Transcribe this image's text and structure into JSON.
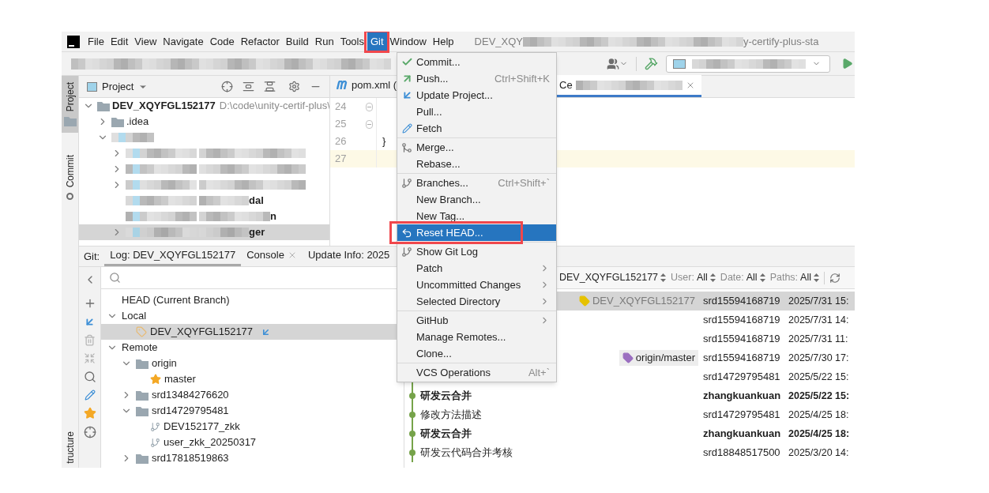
{
  "menubar": {
    "items": [
      {
        "label": "File",
        "selected": false,
        "framed": false
      },
      {
        "label": "Edit",
        "selected": false,
        "framed": false
      },
      {
        "label": "View",
        "selected": false,
        "framed": false
      },
      {
        "label": "Navigate",
        "selected": false,
        "framed": false
      },
      {
        "label": "Code",
        "selected": false,
        "framed": false
      },
      {
        "label": "Refactor",
        "selected": false,
        "framed": false
      },
      {
        "label": "Build",
        "selected": false,
        "framed": false
      },
      {
        "label": "Run",
        "selected": false,
        "framed": false
      },
      {
        "label": "Tools",
        "selected": false,
        "framed": false
      },
      {
        "label": "Git",
        "selected": true,
        "framed": true
      },
      {
        "label": "Window",
        "selected": false,
        "framed": false
      },
      {
        "label": "Help",
        "selected": false,
        "framed": false
      }
    ],
    "title_parts": [
      "DEV_XQY",
      "y-certify-plus-sta"
    ]
  },
  "side_tabs": [
    {
      "label": "Project",
      "kind": "project",
      "selected": true
    },
    {
      "label": "Commit",
      "kind": "commit",
      "selected": false
    }
  ],
  "bottom_side_tab": {
    "label": "tructure"
  },
  "project_panel": {
    "title": "Project",
    "tree": [
      {
        "kind": "node",
        "label": "DEV_XQYFGL152177",
        "path": "D:\\code\\unity-certif-plus\\",
        "expanded": true,
        "selected": false,
        "children": [
          {
            "kind": "node",
            "label": ".idea",
            "expanded": false,
            "selected": false
          },
          {
            "kind": "blurred",
            "expanded": true,
            "selected": false,
            "children": [
              {
                "kind": "blurred",
                "expanded": false,
                "selected": false
              },
              {
                "kind": "blurred",
                "expanded": false,
                "selected": false
              },
              {
                "kind": "blurred",
                "expanded": false,
                "selected": false
              },
              {
                "kind": "blurred",
                "tail": "dal",
                "selected": false
              },
              {
                "kind": "blurred",
                "tail": "n",
                "selected": false
              },
              {
                "kind": "blurred",
                "tail": "ger",
                "expanded": false,
                "selected": true
              }
            ]
          }
        ]
      }
    ]
  },
  "editor": {
    "tabs": [
      {
        "label": "pom.xml (",
        "kind": "maven",
        "selected": false,
        "closable": false
      },
      {
        "label": "Ce",
        "kind": "blurred",
        "selected": true,
        "closable": true
      }
    ],
    "lines": [
      {
        "number": "24",
        "fold": true,
        "current": false
      },
      {
        "number": "25",
        "fold": true,
        "current": false
      },
      {
        "number": "26",
        "code": "}",
        "fold": false,
        "current": false
      },
      {
        "number": "27",
        "fold": false,
        "current": true
      }
    ]
  },
  "git_panel": {
    "label": "Git:",
    "tabs": [
      {
        "label": "Log: DEV_XQYFGL152177",
        "selected": true,
        "closable": false
      },
      {
        "label": "Console",
        "selected": false,
        "closable": true
      },
      {
        "label": "Update Info: 2025",
        "selected": false,
        "closable": false
      }
    ],
    "branches": [
      {
        "label": "HEAD (Current Branch)",
        "selected": false
      },
      {
        "label": "Local",
        "expanded": true,
        "selected": false,
        "children": [
          {
            "label": "DEV_XQYFGL152177",
            "kind": "local",
            "current": true,
            "selected": true
          }
        ]
      },
      {
        "label": "Remote",
        "expanded": true,
        "selected": false,
        "children": [
          {
            "label": "origin",
            "kind": "folder",
            "expanded": true,
            "selected": false,
            "children": [
              {
                "label": "master",
                "kind": "favorite",
                "selected": false
              }
            ]
          },
          {
            "label": "srd13484276620",
            "kind": "folder",
            "expanded": false,
            "selected": false
          },
          {
            "label": "srd14729795481",
            "kind": "folder",
            "expanded": true,
            "selected": false,
            "children": [
              {
                "label": "DEV152177_zkk",
                "kind": "branch",
                "selected": false
              },
              {
                "label": "user_zkk_20250317",
                "kind": "branch",
                "selected": false
              }
            ]
          },
          {
            "label": "srd17818519863",
            "kind": "folder",
            "expanded": false,
            "selected": false
          }
        ]
      }
    ],
    "filters": [
      {
        "value": "DEV_XQYFGL152177"
      },
      {
        "label": "User:",
        "value": "All"
      },
      {
        "label": "Date:",
        "value": "All"
      },
      {
        "label": "Paths:",
        "value": "All"
      }
    ],
    "commits": [
      {
        "refs": [
          {
            "label": "DEV_XQYFGL152177",
            "color": "#e6c200"
          }
        ],
        "author": "srd15594168719",
        "date": "2025/7/31 15:",
        "bold": false,
        "selected": true
      },
      {
        "author": "srd15594168719",
        "date": "2025/7/31 14:",
        "bold": false,
        "selected": false
      },
      {
        "author": "srd15594168719",
        "date": "2025/7/31 11:",
        "bold": false,
        "selected": false
      },
      {
        "refs": [
          {
            "label": "origin/master",
            "color": "#9b6fc0"
          }
        ],
        "author": "srd15594168719",
        "date": "2025/7/30 17:",
        "bold": false,
        "selected": false
      },
      {
        "author": "srd14729795481",
        "date": "2025/5/22 15:",
        "bold": false,
        "selected": false,
        "graph": true
      },
      {
        "subject": "研发云合并",
        "author": "zhangkuankuan",
        "date": "2025/5/22 15:",
        "bold": true,
        "selected": false,
        "graph": true
      },
      {
        "subject": "修改方法描述",
        "author": "srd14729795481",
        "date": "2025/4/25 18:",
        "bold": false,
        "selected": false,
        "graph": true
      },
      {
        "subject": "研发云合并",
        "author": "zhangkuankuan",
        "date": "2025/4/25 18:",
        "bold": true,
        "selected": false,
        "graph": true
      },
      {
        "subject": "研发云代码合并考核",
        "author": "srd18848517500",
        "date": "2025/3/20 14:",
        "bold": false,
        "selected": false,
        "graph": true
      }
    ]
  },
  "git_menu": {
    "groups": [
      [
        {
          "label": "Commit...",
          "kind": "commit",
          "selected": false,
          "framed": false
        },
        {
          "label": "Push...",
          "shortcut": "Ctrl+Shift+K",
          "kind": "push",
          "selected": false,
          "framed": false
        },
        {
          "label": "Update Project...",
          "kind": "update",
          "selected": false,
          "framed": false
        },
        {
          "label": "Pull...",
          "kind": "plain",
          "selected": false,
          "framed": false
        },
        {
          "label": "Fetch",
          "kind": "fetch",
          "selected": false,
          "framed": false
        }
      ],
      [
        {
          "label": "Merge...",
          "kind": "merge",
          "selected": false,
          "framed": false
        },
        {
          "label": "Rebase...",
          "kind": "plain",
          "selected": false,
          "framed": false
        }
      ],
      [
        {
          "label": "Branches...",
          "shortcut": "Ctrl+Shift+`",
          "kind": "branch",
          "selected": false,
          "framed": false
        },
        {
          "label": "New Branch...",
          "kind": "plain",
          "selected": false,
          "framed": false
        },
        {
          "label": "New Tag...",
          "kind": "plain",
          "selected": false,
          "framed": false
        },
        {
          "label": "Reset HEAD...",
          "kind": "reset",
          "selected": true,
          "framed": true
        }
      ],
      [
        {
          "label": "Show Git Log",
          "kind": "branch",
          "selected": false,
          "framed": false
        },
        {
          "label": "Patch",
          "kind": "plain",
          "submenu": true,
          "selected": false,
          "framed": false
        },
        {
          "label": "Uncommitted Changes",
          "kind": "plain",
          "submenu": true,
          "selected": false,
          "framed": false
        },
        {
          "label": "Selected Directory",
          "kind": "plain",
          "submenu": true,
          "selected": false,
          "framed": false
        }
      ],
      [
        {
          "label": "GitHub",
          "kind": "plain",
          "submenu": true,
          "selected": false,
          "framed": false
        },
        {
          "label": "Manage Remotes...",
          "kind": "plain",
          "selected": false,
          "framed": false
        },
        {
          "label": "Clone...",
          "kind": "plain",
          "selected": false,
          "framed": false
        }
      ],
      [
        {
          "label": "VCS Operations",
          "shortcut": "Alt+`",
          "kind": "plain",
          "selected": false,
          "framed": false
        }
      ]
    ]
  }
}
